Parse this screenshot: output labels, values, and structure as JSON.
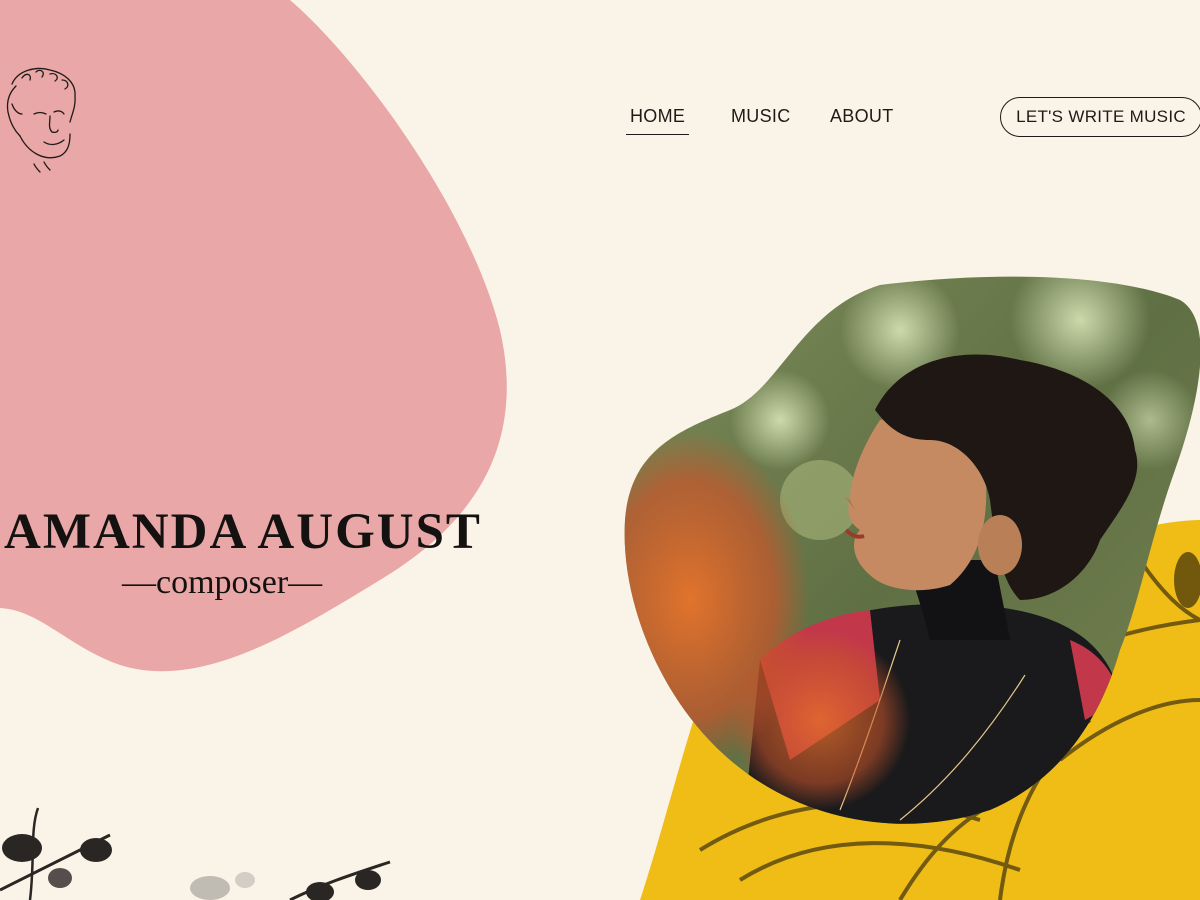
{
  "colors": {
    "background": "#faf4e8",
    "pink_blob": "#e9a7a7",
    "yellow_blob": "#f0bd16",
    "text": "#1e1a18"
  },
  "logo": {
    "icon": "sketched-face-portrait"
  },
  "nav": {
    "items": [
      {
        "label": "HOME",
        "active": true
      },
      {
        "label": "MUSIC",
        "active": false
      },
      {
        "label": "ABOUT",
        "active": false
      }
    ],
    "cta_label": "LET'S WRITE MUSIC"
  },
  "hero": {
    "name": "AMANDA AUGUST",
    "role": "—composer—"
  },
  "images": {
    "portrait": "photo-of-person-with-curly-hair-among-leaves",
    "decor_bottom_left": "ink-flower-branches",
    "decor_bottom_right": "yellow-leaf-illustration"
  }
}
